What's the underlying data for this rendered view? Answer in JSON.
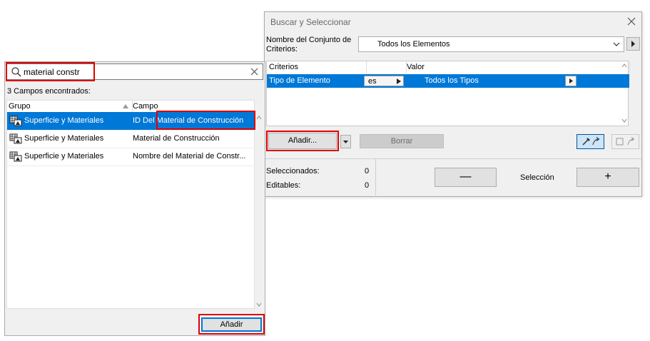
{
  "dialog": {
    "title": "Buscar y Seleccionar",
    "criteria_set_label": "Nombre del Conjunto de Criterios:",
    "criteria_set_value": "Todos los Elementos",
    "table": {
      "headers": {
        "criteria": "Criterios",
        "value": "Valor"
      },
      "rows": [
        {
          "criterion": "Tipo de Elemento",
          "operator": "es",
          "value": "Todos los Tipos"
        }
      ]
    },
    "add_label": "Añadir...",
    "delete_label": "Borrar",
    "selected_label": "Seleccionados:",
    "selected_count": "0",
    "editable_label": "Editables:",
    "editable_count": "0",
    "deselect_label": "—",
    "selection_label": "Selección",
    "select_label": "+"
  },
  "field_panel": {
    "search_value": "material constr",
    "results_count": "3 Campos encontrados:",
    "headers": {
      "group": "Grupo",
      "field": "Campo"
    },
    "rows": [
      {
        "group": "Superficie y Materiales",
        "field": "ID Del Material de Construcción"
      },
      {
        "group": "Superficie y Materiales",
        "field": "Material de Construcción"
      },
      {
        "group": "Superficie y Materiales",
        "field": "Nombre del Material de Constr..."
      }
    ],
    "add_label": "Añadir"
  },
  "colors": {
    "selection": "#0078d7",
    "highlight": "#e00000",
    "disabled_button": "#cccccc"
  }
}
